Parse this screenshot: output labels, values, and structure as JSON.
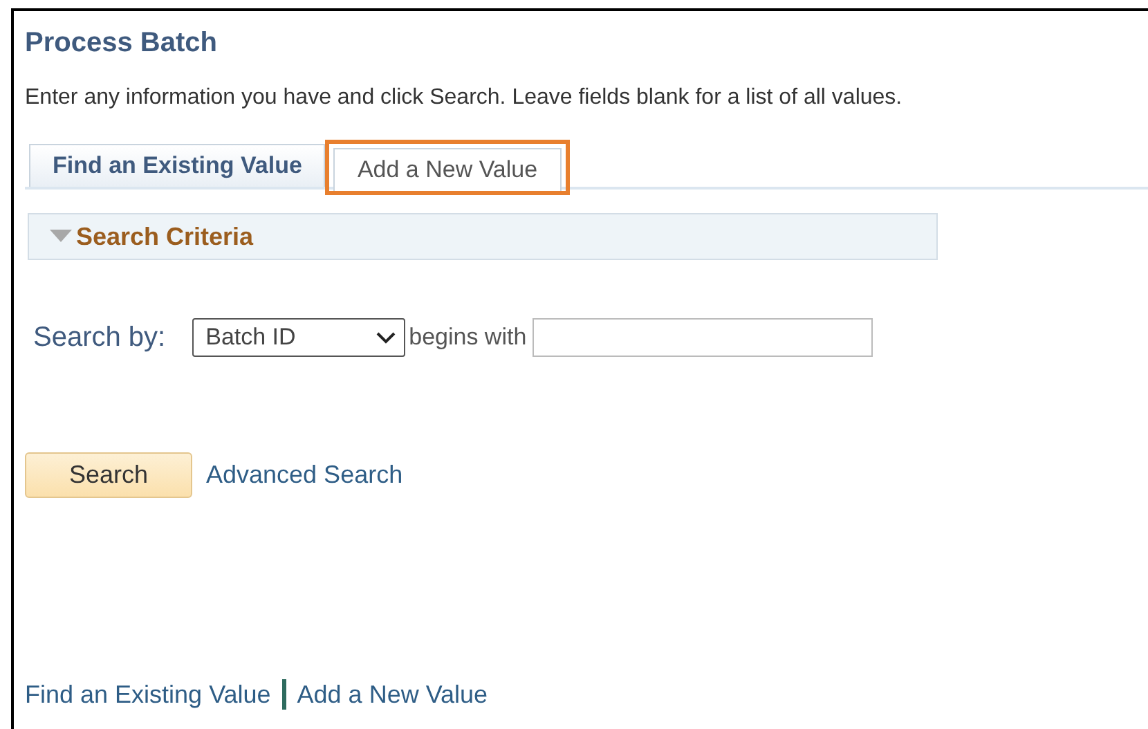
{
  "page": {
    "title": "Process Batch",
    "instructions": "Enter any information you have and click Search. Leave fields blank for a list of all values."
  },
  "tabs": [
    {
      "label": "Find an Existing Value",
      "selected": true,
      "highlighted": false
    },
    {
      "label": "Add a New Value",
      "selected": false,
      "highlighted": true
    }
  ],
  "search_criteria": {
    "title": "Search Criteria",
    "expanded": true,
    "search_by_label": "Search by:",
    "field": "Batch ID",
    "operator": "begins with"
  },
  "buttons": {
    "search": "Search",
    "advanced_search": "Advanced Search"
  },
  "footer_links": [
    "Find an Existing Value",
    "Add a New Value"
  ]
}
